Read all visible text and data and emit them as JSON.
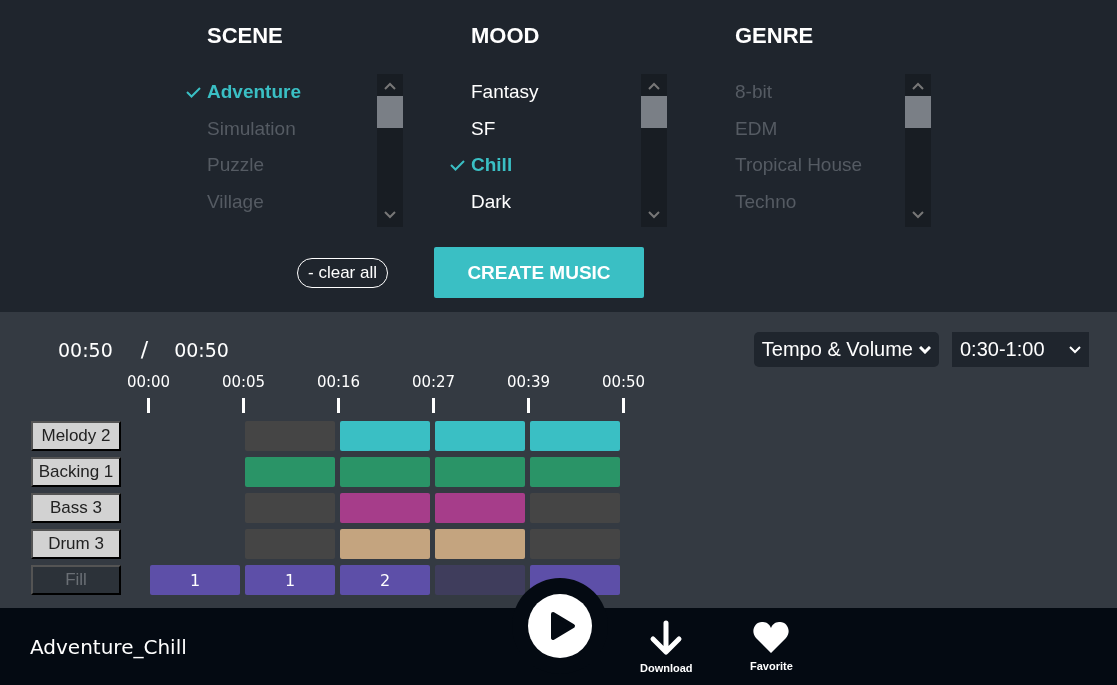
{
  "filters": [
    {
      "heading": "SCENE",
      "items": [
        {
          "label": "Adventure",
          "selected": true,
          "dimmed": false
        },
        {
          "label": "Simulation",
          "selected": false,
          "dimmed": true
        },
        {
          "label": "Puzzle",
          "selected": false,
          "dimmed": true
        },
        {
          "label": "Village",
          "selected": false,
          "dimmed": true
        }
      ]
    },
    {
      "heading": "MOOD",
      "items": [
        {
          "label": "Fantasy",
          "selected": false,
          "dimmed": false
        },
        {
          "label": "SF",
          "selected": false,
          "dimmed": false
        },
        {
          "label": "Chill",
          "selected": true,
          "dimmed": false
        },
        {
          "label": "Dark",
          "selected": false,
          "dimmed": false
        }
      ]
    },
    {
      "heading": "GENRE",
      "items": [
        {
          "label": "8-bit",
          "selected": false,
          "dimmed": true
        },
        {
          "label": "EDM",
          "selected": false,
          "dimmed": true
        },
        {
          "label": "Tropical House",
          "selected": false,
          "dimmed": true
        },
        {
          "label": "Techno",
          "selected": false,
          "dimmed": true
        }
      ]
    }
  ],
  "clear_button": "clear all",
  "clear_icon": "-",
  "create_button": "CREATE MUSIC",
  "player": {
    "current_time": "00:50",
    "separator": "/",
    "total_time": "00:50"
  },
  "dropdowns": [
    {
      "value": "Tempo & Volume"
    },
    {
      "value": "0:30-1:00"
    }
  ],
  "timeline": [
    "00:00",
    "00:05",
    "00:16",
    "00:27",
    "00:39",
    "00:50"
  ],
  "tracks": [
    {
      "label": "Melody 2",
      "enabled": true,
      "color": "#3abfc4",
      "cells": [
        {
          "kind": "empty"
        },
        {
          "kind": "off"
        },
        {
          "kind": "on"
        },
        {
          "kind": "on"
        },
        {
          "kind": "on"
        }
      ]
    },
    {
      "label": "Backing 1",
      "enabled": true,
      "color": "#2a9467",
      "cells": [
        {
          "kind": "empty"
        },
        {
          "kind": "on"
        },
        {
          "kind": "on"
        },
        {
          "kind": "on"
        },
        {
          "kind": "on"
        }
      ]
    },
    {
      "label": "Bass 3",
      "enabled": true,
      "color": "#a63d8a",
      "cells": [
        {
          "kind": "empty"
        },
        {
          "kind": "off"
        },
        {
          "kind": "on"
        },
        {
          "kind": "on"
        },
        {
          "kind": "off"
        }
      ]
    },
    {
      "label": "Drum 3",
      "enabled": true,
      "color": "#c4a47f",
      "cells": [
        {
          "kind": "empty"
        },
        {
          "kind": "off"
        },
        {
          "kind": "on"
        },
        {
          "kind": "on"
        },
        {
          "kind": "off"
        }
      ]
    },
    {
      "label": "Fill",
      "enabled": false,
      "color": "#5d4fa8",
      "cells": [
        {
          "kind": "fill",
          "text": "1"
        },
        {
          "kind": "fill",
          "text": "1"
        },
        {
          "kind": "fill",
          "text": "2"
        },
        {
          "kind": "muted"
        },
        {
          "kind": "fill"
        }
      ]
    }
  ],
  "footer": {
    "title": "Adventure_Chill",
    "actions": [
      {
        "kind": "download",
        "label": "Download"
      },
      {
        "kind": "favorite",
        "label": "Favorite"
      }
    ]
  }
}
